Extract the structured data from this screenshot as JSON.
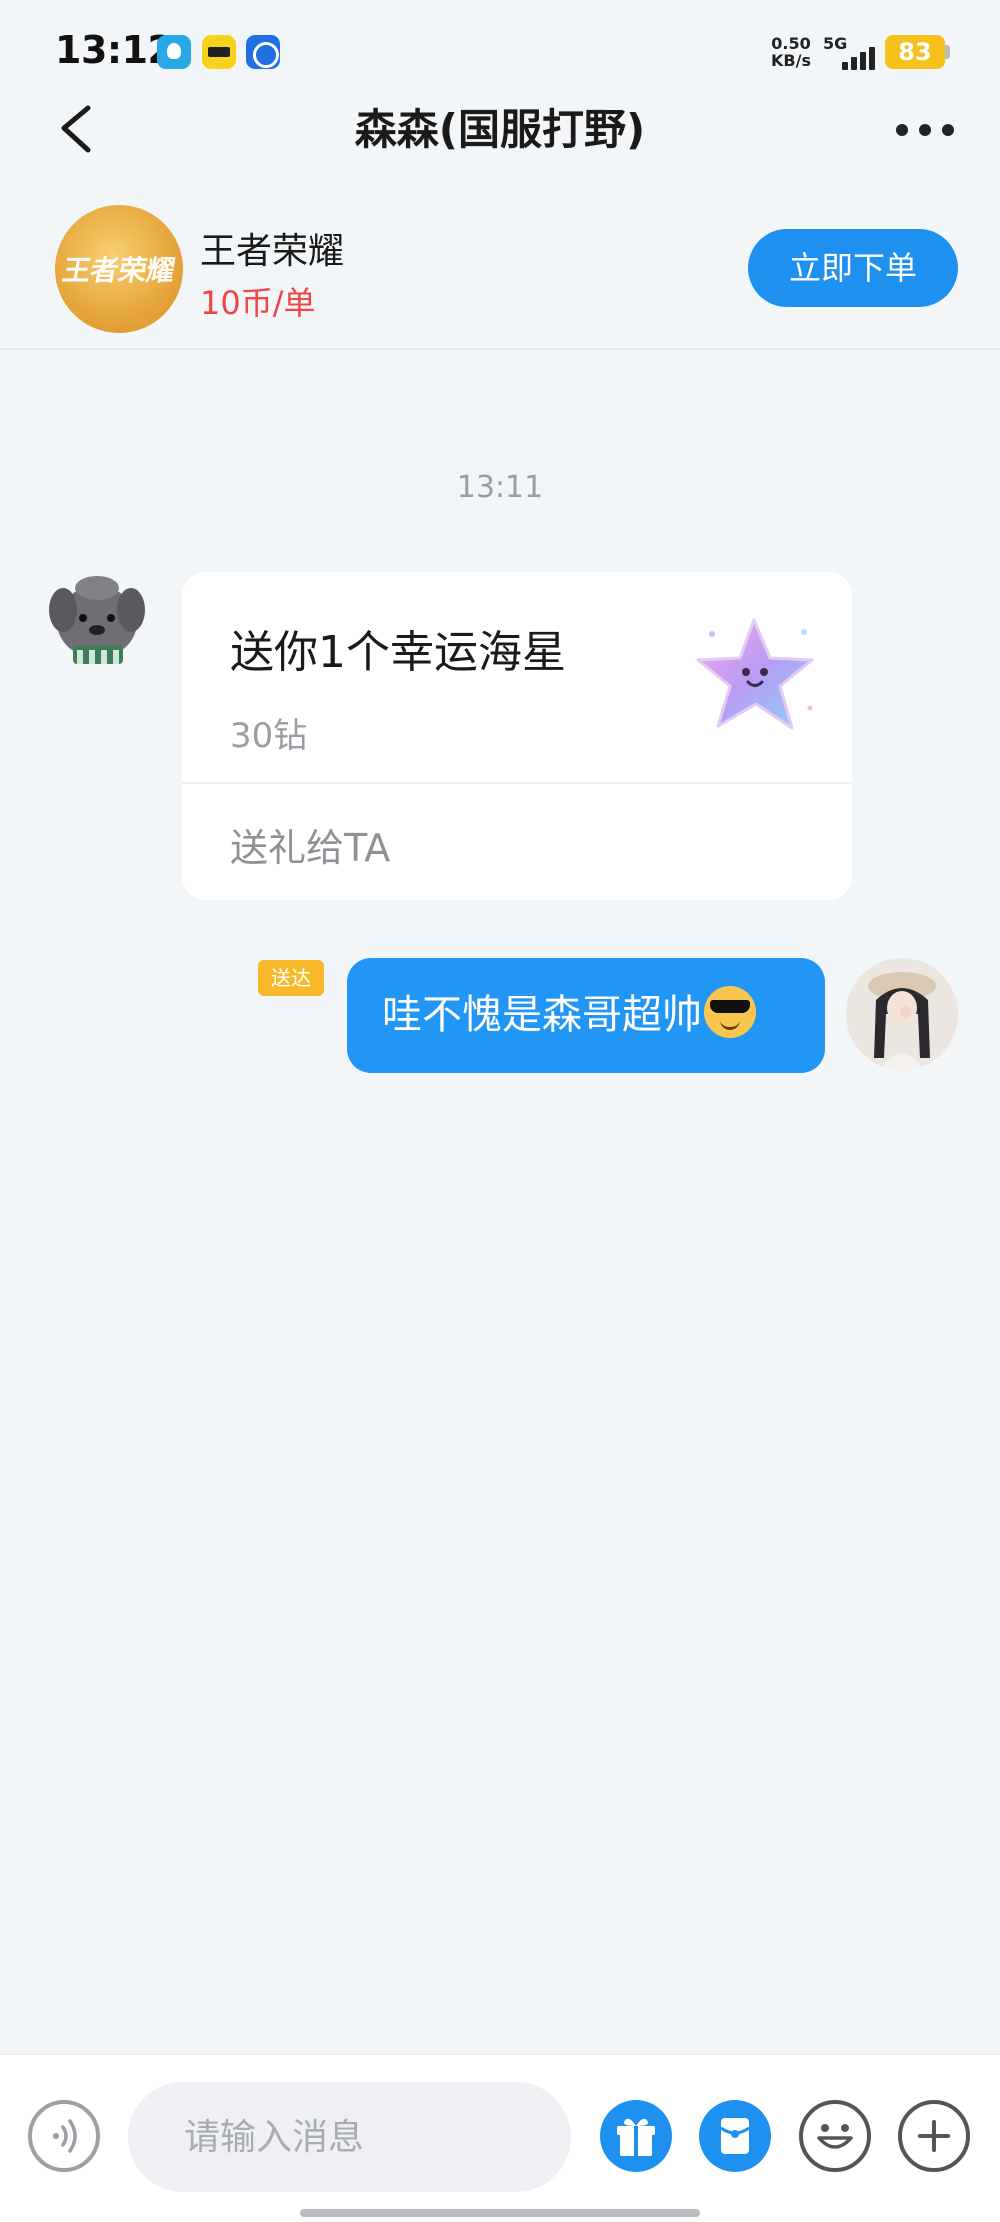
{
  "status_bar": {
    "time": "13:12",
    "net_speed_value": "0.50",
    "net_speed_unit": "KB/s",
    "network_type": "5G",
    "battery": "83",
    "app_icons": [
      "blue-app-icon",
      "yellow-app-icon",
      "browser-icon"
    ]
  },
  "header": {
    "title": "森森(国服打野)"
  },
  "service": {
    "logo_text": "王者荣耀",
    "game_name": "王者荣耀",
    "price": "10币/单",
    "order_button": "立即下单"
  },
  "chat": {
    "timestamp": "13:11",
    "gift_message": {
      "title": "送你1个幸运海星",
      "price": "30钻",
      "action": "送礼给TA"
    },
    "sent_message": {
      "status": "送达",
      "text": "哇不愧是森哥超帅"
    }
  },
  "input": {
    "placeholder": "请输入消息"
  },
  "colors": {
    "accent": "#1e90f0",
    "price_red": "#f04545",
    "badge_yellow": "#f7b92a",
    "background": "#f3f6f9"
  }
}
